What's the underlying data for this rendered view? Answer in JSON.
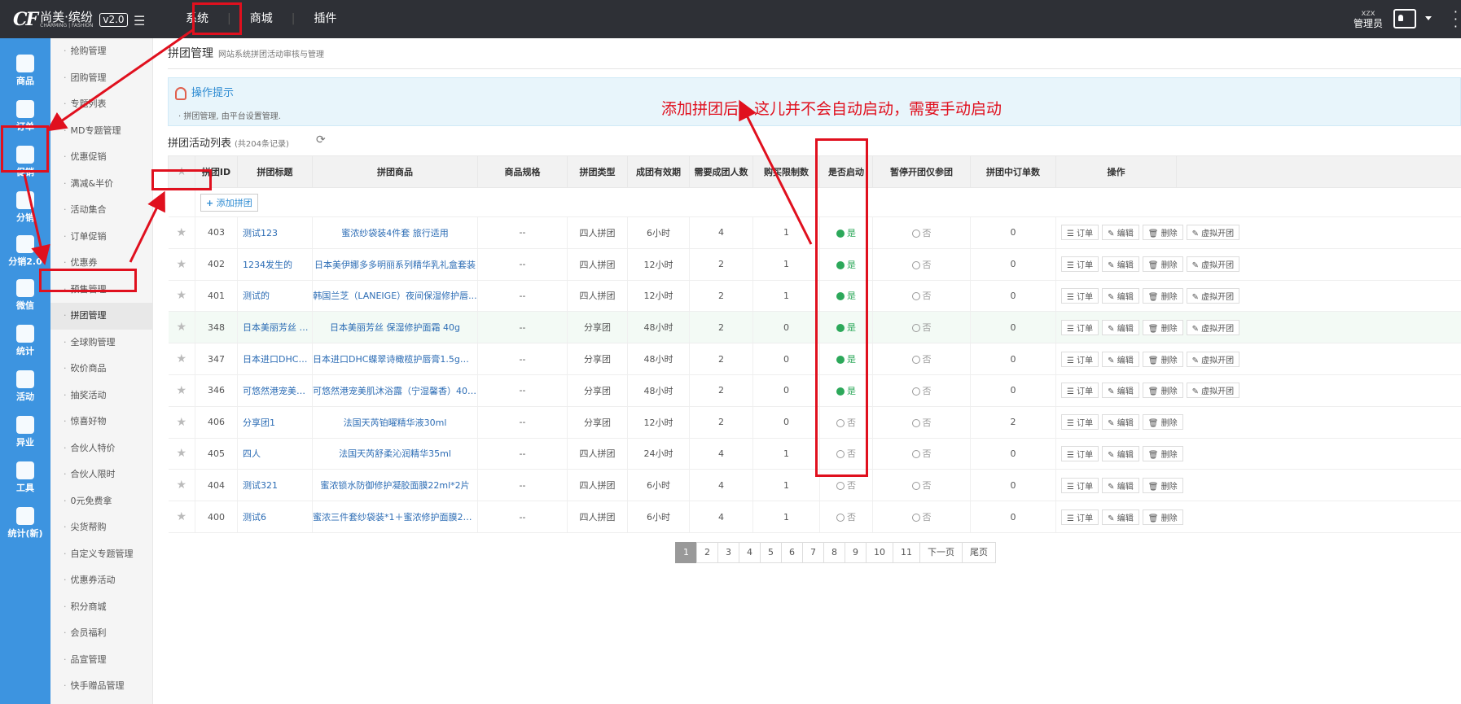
{
  "brand": {
    "logo_mark": "CF",
    "name": "尚美·缤纷",
    "sub": "CHARMING | FASHION",
    "version": "v2.0"
  },
  "top_nav": [
    "系统",
    "商城",
    "插件"
  ],
  "user": {
    "id": "xzx",
    "role": "管理员"
  },
  "left1": [
    {
      "label": "商品",
      "icon": "bag-icon"
    },
    {
      "label": "订单",
      "icon": "store-icon"
    },
    {
      "label": "促销",
      "icon": "promo-icon"
    },
    {
      "label": "分销",
      "icon": "distribution-icon"
    },
    {
      "label": "分销2.0",
      "icon": "distribution2-icon"
    },
    {
      "label": "微信",
      "icon": "wechat-icon"
    },
    {
      "label": "统计",
      "icon": "database-icon"
    },
    {
      "label": "活动",
      "icon": "activity-icon"
    },
    {
      "label": "异业",
      "icon": "lock-icon"
    },
    {
      "label": "工具",
      "icon": "tool-icon"
    },
    {
      "label": "统计(新)",
      "icon": "stats-icon"
    }
  ],
  "left2": [
    "抢购管理",
    "团购管理",
    "专题列表",
    "MD专题管理",
    "优惠促销",
    "满减&半价",
    "活动集合",
    "订单促销",
    "优惠券",
    "预售管理",
    "拼团管理",
    "全球购管理",
    "砍价商品",
    "抽奖活动",
    "惊喜好物",
    "合伙人特价",
    "合伙人限时",
    "0元免费拿",
    "尖货帮购",
    "自定义专题管理",
    "优惠券活动",
    "积分商城",
    "会员福利",
    "品宣管理",
    "快手赠品管理"
  ],
  "page": {
    "title": "拼团管理",
    "subtitle": "网站系统拼团活动审核与管理"
  },
  "tips": {
    "title": "操作提示",
    "line": "拼团管理, 由平台设置管理."
  },
  "annotation": "添加拼团后，这儿并不会自动启动，需要手动启动",
  "list": {
    "title": "拼团活动列表",
    "count": "(共204条记录)",
    "add_label": "添加拼团"
  },
  "columns": [
    "拼团ID",
    "拼团标题",
    "拼团商品",
    "商品规格",
    "拼团类型",
    "成团有效期",
    "需要成团人数",
    "购买限制数",
    "是否启动",
    "暂停开团仅参团",
    "拼团中订单数",
    "操作"
  ],
  "rows": [
    {
      "id": "403",
      "title": "测试123",
      "goods": "蜜浓纱袋装4件套 旅行适用",
      "spec": "--",
      "type": "四人拼团",
      "valid": "6小时",
      "need": "4",
      "limit": "1",
      "on": "是",
      "pause": "否",
      "orders": "0",
      "virtual": true
    },
    {
      "id": "402",
      "title": "1234发生的",
      "goods": "日本美伊娜多多明丽系列精华乳礼盒套装",
      "spec": "--",
      "type": "四人拼团",
      "valid": "12小时",
      "need": "2",
      "limit": "1",
      "on": "是",
      "pause": "否",
      "orders": "0",
      "virtual": true
    },
    {
      "id": "401",
      "title": "测试的",
      "goods": "韩国兰芝（LANEIGE）夜间保湿修护唇...",
      "spec": "--",
      "type": "四人拼团",
      "valid": "12小时",
      "need": "2",
      "limit": "1",
      "on": "是",
      "pause": "否",
      "orders": "0",
      "virtual": true
    },
    {
      "id": "348",
      "title": "日本美丽芳丝 保...",
      "goods": "日本美丽芳丝 保湿修护面霜 40g",
      "spec": "--",
      "type": "分享团",
      "valid": "48小时",
      "need": "2",
      "limit": "0",
      "on": "是",
      "pause": "否",
      "orders": "0",
      "virtual": true
    },
    {
      "id": "347",
      "title": "日本进口DHC蝶...",
      "goods": "日本进口DHC蝶翠诗橄榄护唇膏1.5g（...",
      "spec": "--",
      "type": "分享团",
      "valid": "48小时",
      "need": "2",
      "limit": "0",
      "on": "是",
      "pause": "否",
      "orders": "0",
      "virtual": true
    },
    {
      "id": "346",
      "title": "可悠然港宠美肌...",
      "goods": "可悠然港宠美肌沐浴露（宁湿馨香）400m...",
      "spec": "--",
      "type": "分享团",
      "valid": "48小时",
      "need": "2",
      "limit": "0",
      "on": "是",
      "pause": "否",
      "orders": "0",
      "virtual": true
    },
    {
      "id": "406",
      "title": "分享团1",
      "goods": "法国天芮铂曜精华液30ml",
      "spec": "--",
      "type": "分享团",
      "valid": "12小时",
      "need": "2",
      "limit": "0",
      "on": "否",
      "pause": "否",
      "orders": "2",
      "virtual": false
    },
    {
      "id": "405",
      "title": "四人",
      "goods": "法国天芮舒柔沁润精华35ml",
      "spec": "--",
      "type": "四人拼团",
      "valid": "24小时",
      "need": "4",
      "limit": "1",
      "on": "否",
      "pause": "否",
      "orders": "0",
      "virtual": false
    },
    {
      "id": "404",
      "title": "测试321",
      "goods": "蜜浓锁水防御修护凝胶面膜22ml*2片",
      "spec": "--",
      "type": "四人拼团",
      "valid": "6小时",
      "need": "4",
      "limit": "1",
      "on": "否",
      "pause": "否",
      "orders": "0",
      "virtual": false
    },
    {
      "id": "400",
      "title": "测试6",
      "goods": "蜜浓三件套纱袋装*1＋蜜浓修护面膜22m...",
      "spec": "--",
      "type": "四人拼团",
      "valid": "6小时",
      "need": "4",
      "limit": "1",
      "on": "否",
      "pause": "否",
      "orders": "0",
      "virtual": false
    }
  ],
  "ops": [
    "订单",
    "编辑",
    "删除",
    "虚拟开团"
  ],
  "pager": [
    "1",
    "2",
    "3",
    "4",
    "5",
    "6",
    "7",
    "8",
    "9",
    "10",
    "11",
    "下一页",
    "尾页"
  ],
  "colors": {
    "topbar": "#2e3036",
    "sidebar": "#3d94e0",
    "accent": "#2d8bd2",
    "annotation": "#e0101e",
    "yes": "#2ca85a"
  }
}
